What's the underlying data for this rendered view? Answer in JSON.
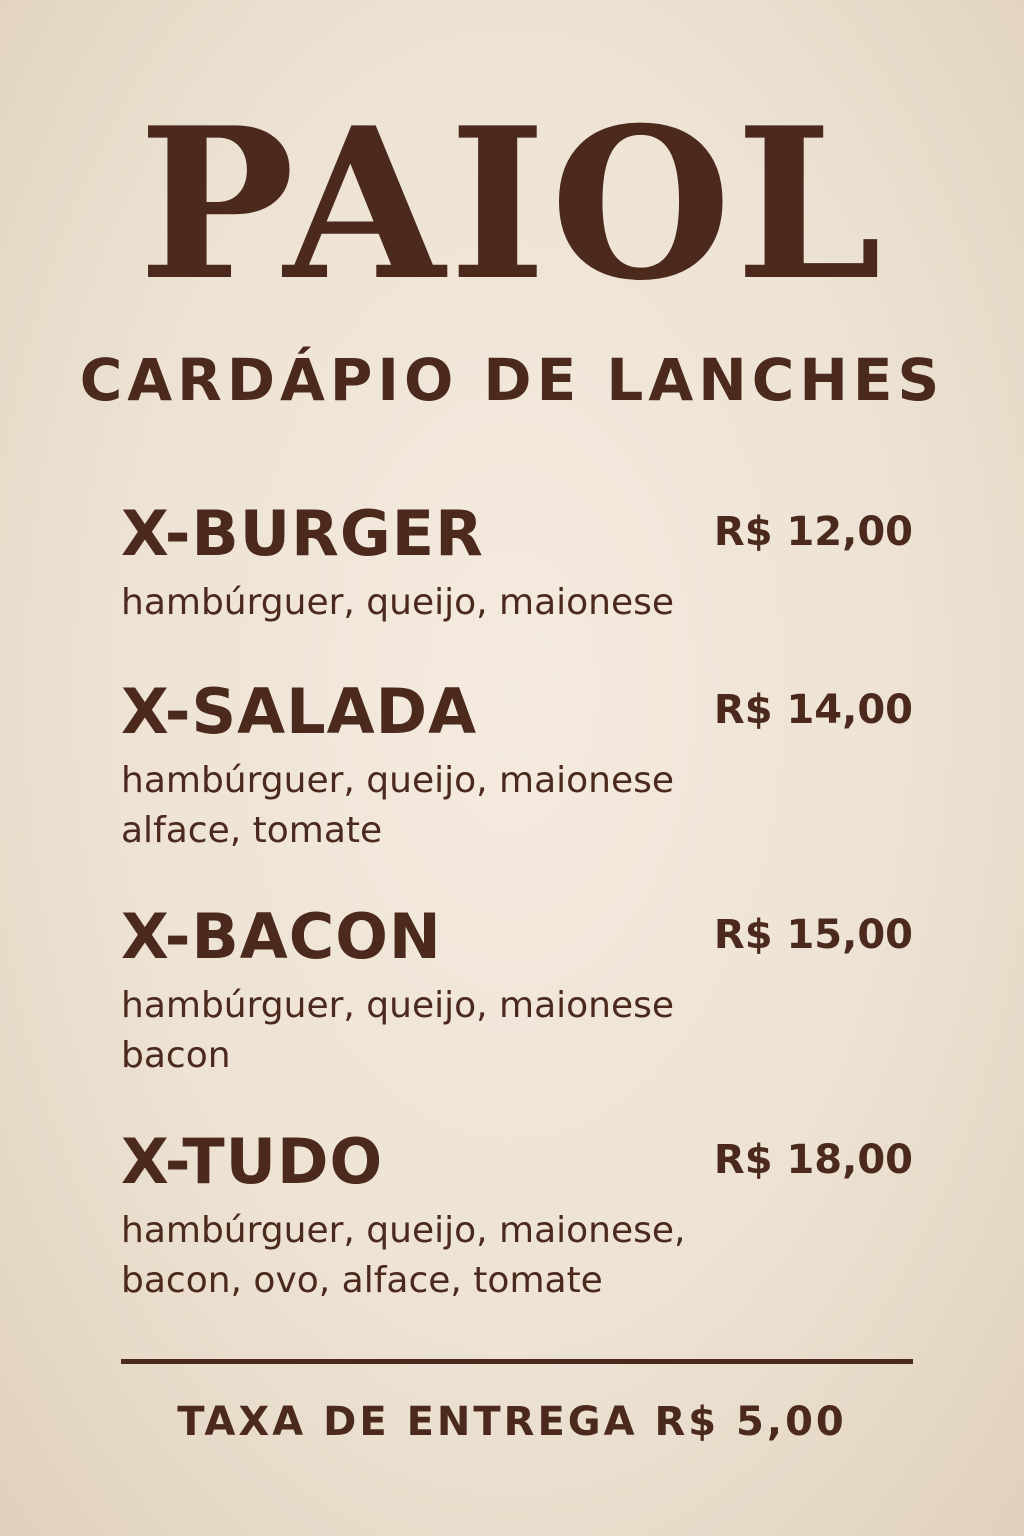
{
  "menu": {
    "title": "PAIOL",
    "subtitle": "CARDÁPIO DE LANCHES",
    "items": [
      {
        "name": "X-BURGER",
        "price": "R$ 12,00",
        "description_lines": [
          "hambúrguer, queijo, maionese"
        ]
      },
      {
        "name": "X-SALADA",
        "price": "R$ 14,00",
        "description_lines": [
          "hambúrguer, queijo, maionese",
          "alface, tomate"
        ]
      },
      {
        "name": "X-BACON",
        "price": "R$ 15,00",
        "description_lines": [
          "hambúrguer, queijo, maionese",
          "bacon"
        ]
      },
      {
        "name": "X-TUDO",
        "price": "R$ 18,00",
        "description_lines": [
          "hambúrguer, queijo, maionese,",
          "bacon, ovo, alface, tomate"
        ]
      }
    ],
    "footer": "TAXA DE ENTREGA R$ 5,00"
  },
  "colors": {
    "background": "#ede2d3",
    "ink": "#4b2a1d"
  }
}
